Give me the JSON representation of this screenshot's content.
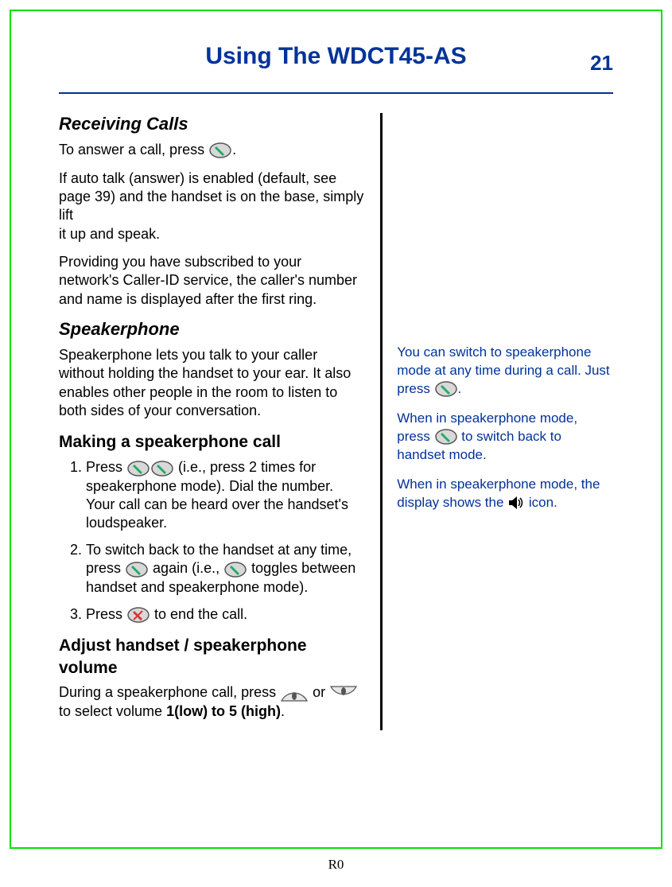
{
  "header": {
    "title": "Using The WDCT45-AS",
    "page_number": "21"
  },
  "footer": "R0",
  "main": {
    "section1": {
      "heading": "Receiving Calls",
      "p1a": "To answer a call, press ",
      "p1b": ".",
      "p2": "If auto talk (answer) is enabled (default, see page 39) and the handset is on the base, simply lift",
      "p2b": "it up and speak.",
      "p3": "Providing you have subscribed to your network's Caller-ID service, the caller's number and name is displayed after the first ring."
    },
    "section2": {
      "heading": "Speakerphone",
      "p1": "Speakerphone lets you talk to your caller without holding the handset to your ear.  It also enables other people in the room to listen to both sides of your conversation."
    },
    "section3": {
      "heading": "Making a speakerphone call",
      "li1a": "Press ",
      "li1b": "  (i.e., press 2 times for speakerphone mode).  Dial the number.  Your call can be heard over the handset's loudspeaker.",
      "li2a": "To switch back to the handset at any time, press ",
      "li2b": " again (i.e., ",
      "li2c": " toggles between handset and speakerphone mode).",
      "li3a": "Press  ",
      "li3b": " to end the call."
    },
    "section4": {
      "heading": "Adjust handset / speakerphone volume",
      "p1a": "During a speakerphone call, press ",
      "p1b": " or ",
      "p1c": " to select volume ",
      "p1d": "1(low) to 5 (high)",
      "p1e": "."
    }
  },
  "side": {
    "p1a": "You can switch to speakerphone mode at any time during a call. Just press ",
    "p1b": ".",
    "p2a": "When in speakerphone mode, press ",
    "p2b": " to switch back to handset mode.",
    "p3a": "When in speakerphone mode, the display shows the  ",
    "p3b": "  icon."
  }
}
